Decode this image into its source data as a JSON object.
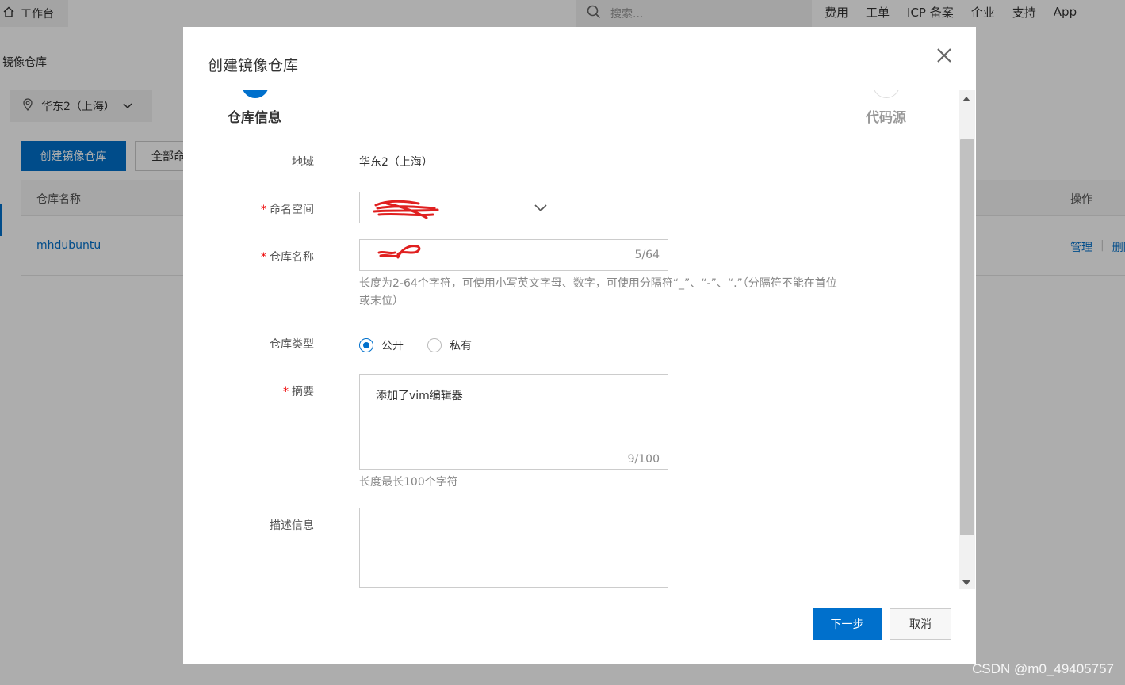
{
  "header": {
    "workbench_label": "工作台",
    "search_placeholder": "搜索...",
    "nav": [
      "费用",
      "工单",
      "ICP 备案",
      "企业",
      "支持",
      "App"
    ]
  },
  "background_page": {
    "breadcrumb": "镜像仓库",
    "region": "华东2（上海）",
    "create_button": "创建镜像仓库",
    "filter_button": "全部命",
    "table": {
      "columns": [
        "仓库名称",
        "操作"
      ],
      "rows": [
        {
          "name": "mhdubuntu",
          "actions": [
            "管理",
            "删除"
          ]
        }
      ]
    }
  },
  "modal": {
    "title": "创建镜像仓库",
    "steps": [
      {
        "label": "仓库信息",
        "active": true
      },
      {
        "label": "代码源",
        "active": false
      }
    ],
    "form": {
      "region_label": "地域",
      "region_value": "华东2（上海）",
      "namespace_label": "命名空间",
      "repo_name_label": "仓库名称",
      "repo_name_counter": "5/64",
      "repo_name_hint_line1": "长度为2-64个字符，可使用小写英文字母、数字，可使用分隔符“_”、“-”、“.”（分隔符不能在首位",
      "repo_name_hint_line2": "或末位）",
      "repo_type_label": "仓库类型",
      "repo_type_options": [
        "公开",
        "私有"
      ],
      "repo_type_selected": "公开",
      "summary_label": "摘要",
      "summary_value": "添加了vim编辑器",
      "summary_counter": "9/100",
      "summary_hint": "长度最长100个字符",
      "description_label": "描述信息",
      "description_value": ""
    },
    "buttons": {
      "next": "下一步",
      "cancel": "取消"
    }
  },
  "watermark": "CSDN @m0_49405757",
  "colors": {
    "primary": "#0070cc",
    "required": "#e00000",
    "redaction": "#e02020"
  }
}
